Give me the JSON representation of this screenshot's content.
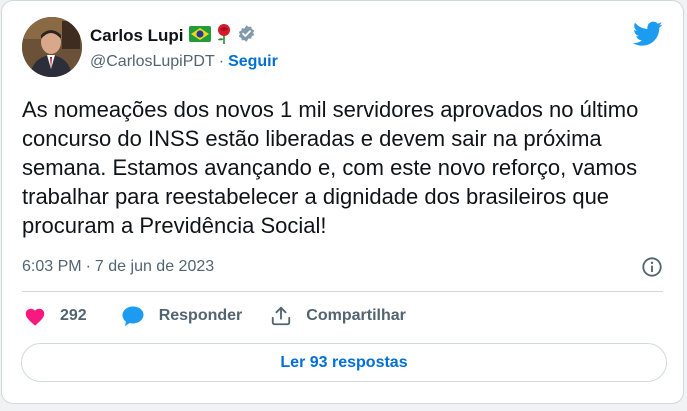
{
  "tweet": {
    "author": {
      "name": "Carlos Lupi",
      "handle": "@CarlosLupiPDT",
      "follow_label": "Seguir",
      "separator": "·"
    },
    "icons": {
      "flag": "brazil-flag-icon",
      "rose": "rose-icon",
      "verified": "verified-badge-icon",
      "logo": "twitter-bird-icon"
    },
    "text": "As nomeações dos novos 1 mil servidores aprovados no último concurso do INSS estão liberadas e devem sair na próxima semana. Estamos avançando e, com este novo reforço, vamos trabalhar para reestabelecer a dignidade dos brasileiros que procuram a Previdência Social!",
    "time": "6:03 PM",
    "separator": "·",
    "date": "7 de jun de 2023",
    "actions": {
      "likes": "292",
      "reply_label": "Responder",
      "share_label": "Compartilhar"
    },
    "read_replies_label": "Ler 93 respostas"
  },
  "colors": {
    "link": "#006fd6",
    "like": "#f91880",
    "twitter_blue": "#1d9bf0",
    "secondary_text": "#536471"
  }
}
